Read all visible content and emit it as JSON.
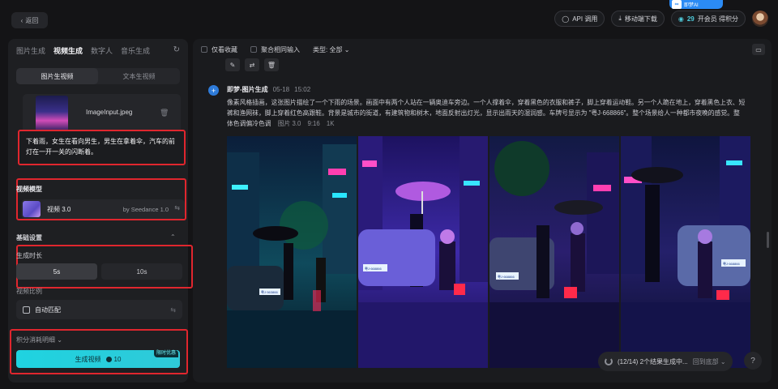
{
  "header": {
    "back_label": "返回",
    "brand_tag": "即梦AI",
    "api_label": "API 调用",
    "download_label": "移动端下载",
    "points": "29",
    "vip_label": "开会员 得积分"
  },
  "sidebar": {
    "tabs": [
      "图片生成",
      "视频生成",
      "数字人",
      "音乐生成"
    ],
    "active_tab": 1,
    "modes": [
      "图片生视频",
      "文本生视频"
    ],
    "image_file": "ImageInput.jpeg",
    "prompt": "下着雨，女生在看向男生，男生在拿着伞，汽车的前灯在一开一关的闪断着。",
    "model_section_title": "视频模型",
    "model_name": "视频 3.0",
    "model_by": "by Seedance 1.0",
    "basic_settings_title": "基础设置",
    "duration_title": "生成时长",
    "duration_options": [
      "5s",
      "10s"
    ],
    "ratio_title": "视频比例",
    "ratio_value": "自动匹配",
    "points_title": "积分消耗明细",
    "generate_label": "生成视频",
    "generate_cost": "10",
    "promo_badge": "限时优惠"
  },
  "main": {
    "filters": {
      "favorites": "仅看收藏",
      "merge": "聚合相同输入",
      "type": "类型: 全部"
    },
    "post": {
      "title": "即梦-图片生成",
      "date": "05-18",
      "time": "15:02",
      "description": "像素风格插画，这张图片描绘了一个下雨的场景。画面中有两个人站在一辆奥迪车旁边。一个人撑着伞，穿着黑色的衣服和裤子，脚上穿着运动鞋。另一个人跪在地上，穿着黑色上衣、短裤和渔网袜，脚上穿着红色高跟鞋。背景是城市的街道，有建筑物和树木，地面反射出灯光，显示出雨天的湿润感。车牌号显示为 \"粤J·668866\"。整个场景给人一种都市夜晚的感觉。整体色调偏冷色调",
      "model": "图片 3.0",
      "ratio": "9:16",
      "resolution": "1K",
      "plates": [
        "粤J·563866",
        "粤J·668866",
        "粤J·668866",
        "粤J·668866"
      ]
    },
    "status": {
      "text": "(12/14) 2个结果生成中...",
      "link": "回到底部"
    },
    "help": "?"
  }
}
